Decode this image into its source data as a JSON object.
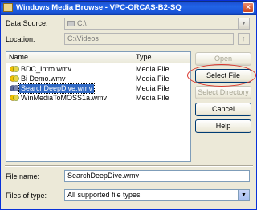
{
  "window": {
    "title": "Windows Media Browse - VPC-ORCAS-B2-SQ",
    "close_glyph": "×"
  },
  "data_source": {
    "label": "Data Source:",
    "value": "C:\\"
  },
  "location": {
    "label": "Location:",
    "value": "C:\\Videos"
  },
  "file_list": {
    "columns": [
      "Name",
      "Type"
    ],
    "rows": [
      {
        "name": "BDC_Intro.wmv",
        "type": "Media File"
      },
      {
        "name": "Bi Demo.wmv",
        "type": "Media File"
      },
      {
        "name": "SearchDeepDive.wmv",
        "type": "Media File"
      },
      {
        "name": "WinMediaToMOSS1a.wmv",
        "type": "Media File"
      }
    ]
  },
  "buttons": {
    "open": "Open",
    "select_file": "Select File",
    "select_directory": "Select Directory",
    "cancel": "Cancel",
    "help": "Help"
  },
  "file_name": {
    "label": "File name:",
    "value": "SearchDeepDive.wmv"
  },
  "files_of_type": {
    "label": "Files of type:",
    "value": "All supported file types"
  },
  "colors": {
    "title_bar": "#2164e6",
    "selection": "#316ac5",
    "annotation": "#d9342b"
  },
  "icons": {
    "up_folder": "↑",
    "dropdown": "▼"
  }
}
